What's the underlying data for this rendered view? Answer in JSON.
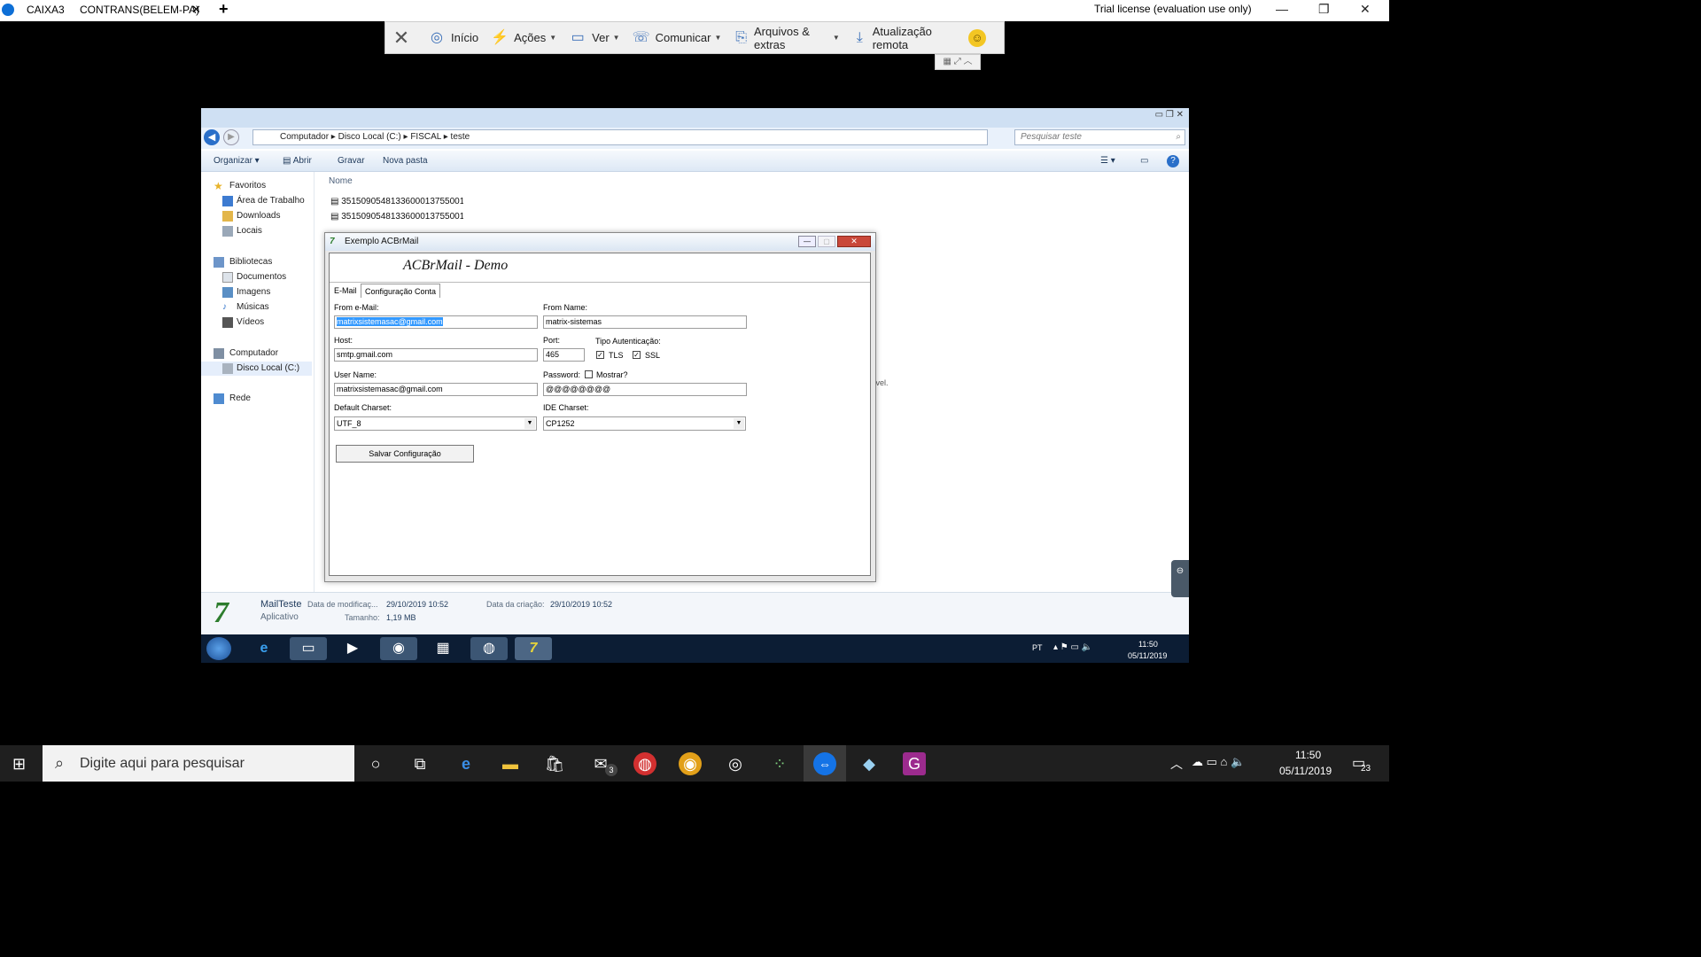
{
  "teamviewer": {
    "tabs": [
      "CAIXA3",
      "CONTRANS(BELEM-PA)"
    ],
    "license_text": "Trial license (evaluation use only)",
    "toolbar": {
      "home": "Início",
      "actions": "Ações",
      "view": "Ver",
      "communicate": "Comunicar",
      "files": "Arquivos & extras",
      "update": "Atualização remota"
    }
  },
  "explorer": {
    "breadcrumb": [
      "Computador",
      "Disco Local (C:)",
      "FISCAL",
      "teste"
    ],
    "search_placeholder": "Pesquisar teste",
    "commands": {
      "organize": "Organizar",
      "open": "Abrir",
      "burn": "Gravar",
      "new_folder": "Nova pasta"
    },
    "nav": {
      "favorites": "Favoritos",
      "desktop": "Área de Trabalho",
      "downloads": "Downloads",
      "places": "Locais",
      "libraries": "Bibliotecas",
      "documents": "Documentos",
      "images": "Imagens",
      "music": "Músicas",
      "videos": "Vídeos",
      "computer": "Computador",
      "local_disk": "Disco Local (C:)",
      "network": "Rede"
    },
    "column_name": "Nome",
    "files": [
      "3515090548133600013755001000",
      "3515090548133600013755001000"
    ],
    "empty_text_fragment": "ível.",
    "details": {
      "name": "MailTeste",
      "type": "Aplicativo",
      "modified_label": "Data de modificaç...",
      "modified_value": "29/10/2019 10:52",
      "created_label": "Data da criação:",
      "created_value": "29/10/2019 10:52",
      "size_label": "Tamanho:",
      "size_value": "1,19 MB"
    },
    "tray": {
      "lang": "PT",
      "time": "11:50",
      "date": "05/11/2019"
    }
  },
  "dialog": {
    "title": "Exemplo ACBrMail",
    "heading": "ACBrMail - Demo",
    "tabs": [
      "E-Mail",
      "Configuração Conta"
    ],
    "from_email_label": "From e-Mail:",
    "from_email_value": "matrixsistemasac@gmail.com",
    "from_name_label": "From Name:",
    "from_name_value": "matrix-sistemas",
    "host_label": "Host:",
    "host_value": "smtp.gmail.com",
    "port_label": "Port:",
    "port_value": "465",
    "auth_label": "Tipo Autenticação:",
    "tls_label": "TLS",
    "ssl_label": "SSL",
    "user_label": "User Name:",
    "user_value": "matrixsistemasac@gmail.com",
    "password_label": "Password:",
    "show_label": "Mostrar?",
    "password_value": "@@@@@@@@",
    "charset_label": "Default Charset:",
    "charset_value": "UTF_8",
    "ide_charset_label": "IDE Charset:",
    "ide_charset_value": "CP1252",
    "save_label": "Salvar Configuração"
  },
  "host_taskbar": {
    "search_placeholder": "Digite aqui para pesquisar",
    "time": "11:50",
    "date": "05/11/2019",
    "mail_badge": "3",
    "notif_count": "23"
  }
}
